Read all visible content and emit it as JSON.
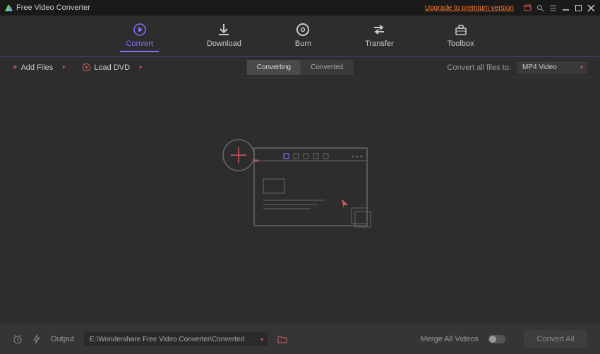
{
  "title": "Free Video Converter",
  "upgrade": "Upgrade to premium version",
  "nav": {
    "convert": "Convert",
    "download": "Download",
    "burn": "Burn",
    "transfer": "Transfer",
    "toolbox": "Toolbox"
  },
  "toolbar": {
    "addFiles": "Add Files",
    "loadDVD": "Load DVD"
  },
  "segment": {
    "converting": "Converting",
    "converted": "Converted"
  },
  "convertTo": {
    "label": "Convert all files to:",
    "value": "MP4 Video"
  },
  "footer": {
    "output": "Output",
    "path": "E:\\Wondershare Free Video Converter\\Converted",
    "merge": "Merge All Videos",
    "convertAll": "Convert All"
  }
}
